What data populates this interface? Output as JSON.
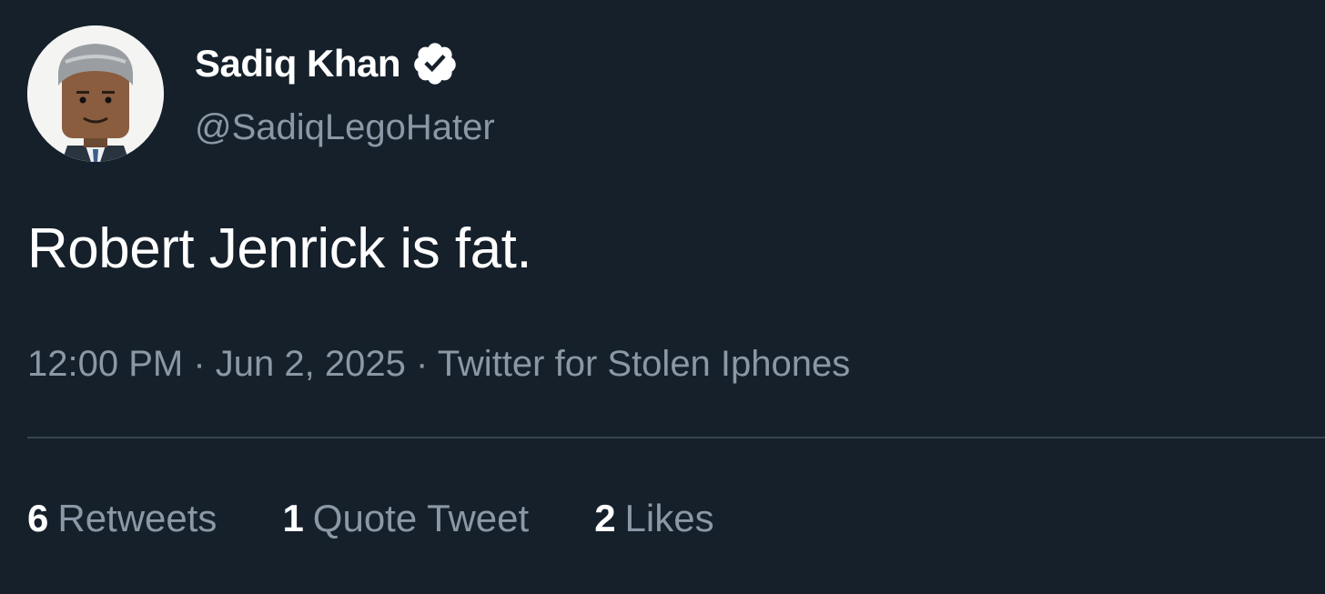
{
  "colors": {
    "background": "#15202b",
    "primary_text": "#ffffff",
    "secondary_text": "#8b98a5",
    "divider": "#38444d",
    "verified_badge": "#ffffff"
  },
  "author": {
    "display_name": "Sadiq Khan",
    "handle": "@SadiqLegoHater",
    "verified_icon": "verified-badge-icon",
    "avatar_icon": "lego-minifigure-avatar"
  },
  "tweet": {
    "text": "Robert Jenrick is fat.",
    "time": "12:00 PM",
    "separator": "·",
    "date": "Jun 2, 2025",
    "source": "Twitter for Stolen Iphones"
  },
  "stats": [
    {
      "count": "6",
      "label": "Retweets"
    },
    {
      "count": "1",
      "label": "Quote Tweet"
    },
    {
      "count": "2",
      "label": "Likes"
    }
  ]
}
